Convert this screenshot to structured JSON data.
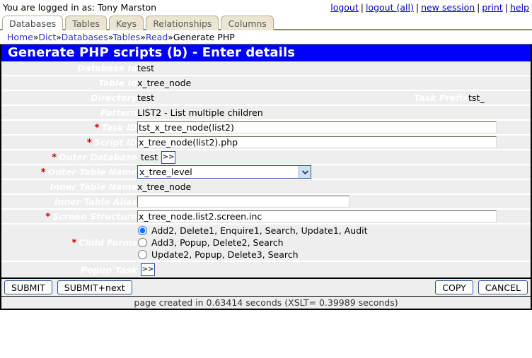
{
  "header": {
    "login_text": "You are logged in as: Tony Marston",
    "links": [
      {
        "label": "logout"
      },
      {
        "label": "logout (all)"
      },
      {
        "label": "new session"
      },
      {
        "label": "print"
      },
      {
        "label": "help"
      }
    ],
    "separator": "|"
  },
  "tabs": [
    {
      "label": "Databases",
      "active": true
    },
    {
      "label": "Tables",
      "active": false
    },
    {
      "label": "Keys",
      "active": false
    },
    {
      "label": "Relationships",
      "active": false
    },
    {
      "label": "Columns",
      "active": false
    }
  ],
  "breadcrumb": {
    "chevron": "»",
    "items": [
      {
        "label": "Home",
        "link": true
      },
      {
        "label": "Dict",
        "link": true
      },
      {
        "label": "Databases",
        "link": true
      },
      {
        "label": "Tables",
        "link": true
      },
      {
        "label": "Read",
        "link": true
      },
      {
        "label": "Generate PHP",
        "link": false
      }
    ]
  },
  "page_title": "Generate PHP scripts (b) - Enter details",
  "form": {
    "required_marker": "*",
    "database_id": {
      "label": "Database Id",
      "value": "test"
    },
    "table_id": {
      "label": "Table Id",
      "value": "x_tree_node"
    },
    "directory": {
      "label": "Directory",
      "value": "test"
    },
    "task_prefix": {
      "label": "Task Prefix",
      "value": "tst_"
    },
    "pattern": {
      "label": "Pattern",
      "value": "LIST2 - List multiple children"
    },
    "task_id": {
      "label": "Task ID",
      "value": "tst_x_tree_node(list2)",
      "placeholder": ""
    },
    "script_id": {
      "label": "Script ID",
      "value": "x_tree_node(list2).php",
      "placeholder": ""
    },
    "outer_database": {
      "label": "Outer Database",
      "value": "test",
      "button_label": ">>"
    },
    "outer_table_name": {
      "label": "Outer Table Name",
      "value": "x_tree_level",
      "options": [
        "x_tree_level"
      ]
    },
    "inner_table_name": {
      "label": "Inner Table Name",
      "value": "x_tree_node"
    },
    "inner_table_alias": {
      "label": "Inner Table Alias",
      "value": "",
      "placeholder": ""
    },
    "screen_structure": {
      "label": "Screen Structure",
      "value": "x_tree_node.list2.screen.inc",
      "placeholder": ""
    },
    "child_forms": {
      "label": "Child Forms",
      "selected_index": 0,
      "options": [
        {
          "label": "Add2, Delete1, Enquire1, Search, Update1, Audit"
        },
        {
          "label": "Add3, Popup, Delete2, Search"
        },
        {
          "label": "Update2, Popup, Delete3, Search"
        }
      ]
    },
    "popup_task": {
      "label": "Popup Task",
      "button_label": ">>"
    }
  },
  "buttons": {
    "submit": "SUBMIT",
    "submit_next": "SUBMIT+next",
    "copy": "COPY",
    "cancel": "CANCEL"
  },
  "status": "page created in 0.63414 seconds (XSLT= 0.39989 seconds)",
  "colors": {
    "title_bg": "#0000ff",
    "label_bg": "#808080",
    "field_bg": "#eeeeee",
    "required": "#cc0000",
    "link": "#0000cc"
  }
}
